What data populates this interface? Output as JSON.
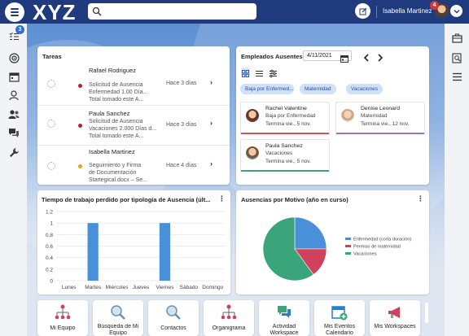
{
  "header": {
    "logo": "XYZ",
    "search_placeholder": "",
    "user_name": "Isabella Martinez",
    "notification_count": "4"
  },
  "sidebar": {
    "tasks_badge": "3",
    "icons": [
      "tasks-icon",
      "target-icon",
      "calendar-icon",
      "person-icon",
      "people-icon",
      "chat-icon",
      "wrench-icon"
    ]
  },
  "right_rail": {
    "icons": [
      "briefcase-icon",
      "search-list-icon",
      "list-icon"
    ]
  },
  "tasks": {
    "title": "Tareas",
    "items": [
      {
        "name": "Rafael Rodriguez",
        "line1": "Solicitud de Ausencia",
        "line2": "Enfermedad 1.00 Día...",
        "line3": "Total tomado este A...",
        "time": "Hace 3 días",
        "status_color": "#b5222a"
      },
      {
        "name": "Paula Sanchez",
        "line1": "Solicitud de Ausencia",
        "line2": "Vacaciones 2.000 Días d...",
        "line3": "Total tomado este A...",
        "time": "Hace 3 días",
        "status_color": "#b5222a"
      },
      {
        "name": "Isabella Martinez",
        "line1": "Seguimiento y Firma",
        "line2": "de Documentación",
        "line3": "Startegical.docx – Se...",
        "time": "Hace 4 días",
        "status_color": "#e8a317"
      }
    ]
  },
  "absentees": {
    "title": "Empleados Ausentes",
    "date": "4/11/2021",
    "filters": [
      "Baja por Enfermed...",
      "Maternidad",
      "Vacaciones"
    ],
    "employees": [
      {
        "name": "Rachel Valentine",
        "reason": "Baja por Enfermedad",
        "ends": "Termina vie., 5 nov.",
        "color": "#d9534f"
      },
      {
        "name": "Denise Leonard",
        "reason": "Maternidad",
        "ends": "Termina vie., 12 nov.",
        "color": "#9b72c9"
      },
      {
        "name": "Paula Sanchez",
        "reason": "Vacaciones",
        "ends": "Termina vie., 5 nov.",
        "color": "#3aa57a"
      }
    ]
  },
  "lost_time_chart": {
    "title": "Tiempo de trabajo perdido por tipología de Ausencia (últ..."
  },
  "reasons_chart": {
    "title": "Ausencias por Motivo (año en curso)"
  },
  "chart_data": [
    {
      "type": "bar",
      "title": "Tiempo de trabajo perdido por tipología de Ausencia (últ...",
      "categories": [
        "Lunes",
        "Martes",
        "Miércoles",
        "Jueves",
        "Viernes",
        "Sábado",
        "Domingo"
      ],
      "values": [
        0,
        1,
        0,
        0,
        1,
        0,
        0
      ],
      "ylim": [
        0,
        1.2
      ],
      "yticks": [
        "0",
        "0.2",
        "0.4",
        "0.6",
        "0.8",
        "1",
        "1.2"
      ],
      "color": "#4a90d9",
      "grid": true
    },
    {
      "type": "pie",
      "title": "Ausencias por Motivo (año en curso)",
      "labels": [
        "Enfermedad (corta duración)",
        "Permiso de maternidad",
        "Vacaciones"
      ],
      "values": [
        25,
        15,
        60
      ],
      "colors": [
        "#4a90d9",
        "#d0425c",
        "#3aa57a"
      ],
      "legend": "right"
    }
  ],
  "tiles": [
    {
      "label": "Mi Equipo",
      "icon": "org-chart-icon"
    },
    {
      "label": "Búsqueda de Mi Equipo",
      "icon": "search-icon"
    },
    {
      "label": "Contactos",
      "icon": "search-icon"
    },
    {
      "label": "Organigrama",
      "icon": "org-chart-icon"
    },
    {
      "label": "Actividad Workspace",
      "icon": "chat-bubbles-icon"
    },
    {
      "label": "Mis Eventos Calendario",
      "icon": "calendar-plus-icon"
    },
    {
      "label": "Mis Workspaces",
      "icon": "megaphone-icon"
    }
  ]
}
